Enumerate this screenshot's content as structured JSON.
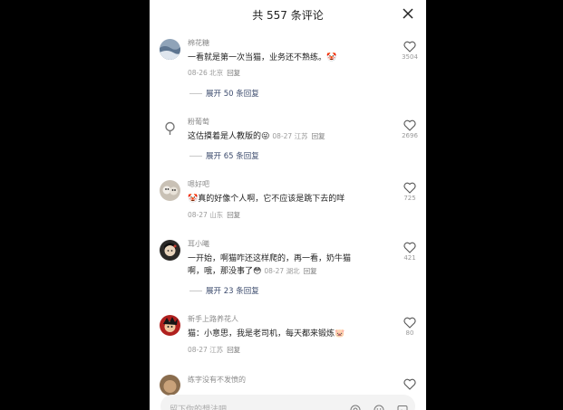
{
  "header": {
    "title": "共 557 条评论",
    "close_icon": "close-icon"
  },
  "comments": [
    {
      "username": "棉花糖",
      "text": "一看就是第一次当猫，业务还不熟练。",
      "emoji": "🤡",
      "meta": "08-26 北京",
      "reply": "回复",
      "likes": "3504",
      "expand": "展开 50 条回复"
    },
    {
      "username": "粉葡萄",
      "text": "这估摸着是人教版的",
      "emoji": "😜",
      "meta": "08-27 江苏",
      "reply": "回复",
      "likes": "2696",
      "expand": "展开 65 条回复"
    },
    {
      "username": "嗯好吧",
      "emoji": "🤡",
      "text": "真的好像个人啊，它不应该是跳下去的咩",
      "meta": "08-27 山东",
      "reply": "回复",
      "likes": "725"
    },
    {
      "username": "耳小曦",
      "text_line1": "一开始，啊猫咋还这样爬的，再一看，奶牛猫",
      "text_line2": "啊，哦，那没事了",
      "emoji": "😳",
      "meta": "08-27 湖北",
      "reply": "回复",
      "likes": "421",
      "expand": "展开 23 条回复"
    },
    {
      "username": "新手上路养花人",
      "text": "猫：小意思，我是老司机，每天都来锻炼",
      "emoji": "🐷",
      "meta": "08-27 江苏",
      "reply": "回复",
      "likes": "80"
    },
    {
      "username": "练字没有不发愤的"
    }
  ],
  "input": {
    "placeholder": "留下你的想法吧",
    "icons": [
      "at-icon",
      "emoji-icon",
      "image-icon"
    ]
  }
}
